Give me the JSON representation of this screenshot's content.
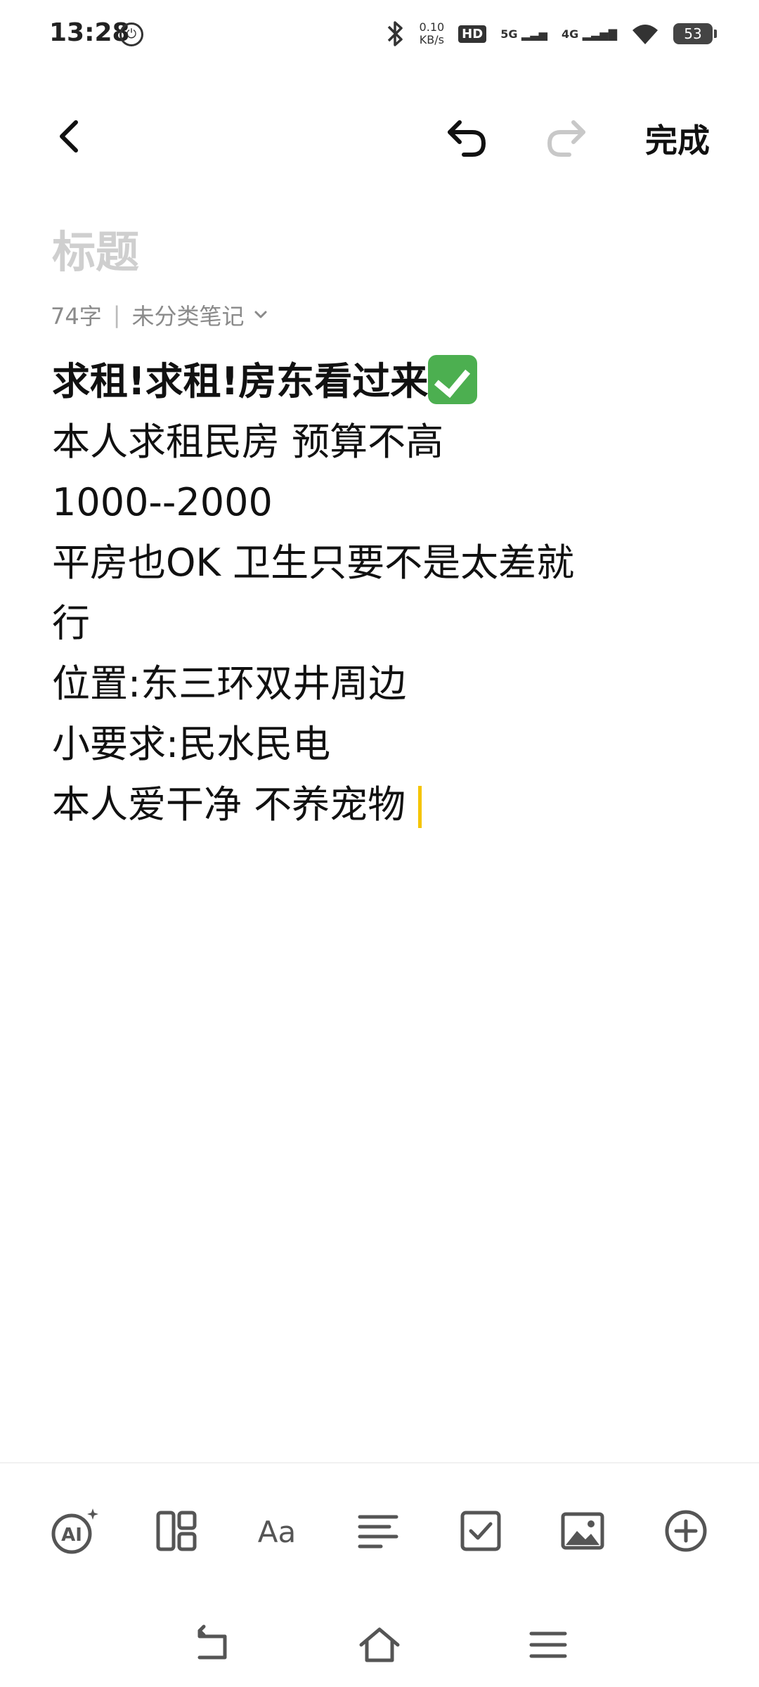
{
  "status_bar": {
    "time": "13:28",
    "network_speed_value": "0.10",
    "network_speed_unit": "KB/s",
    "hd_label": "HD",
    "sim1_label": "5G",
    "sim2_label": "4G",
    "battery": "53"
  },
  "toolbar": {
    "done_label": "完成"
  },
  "note": {
    "title_placeholder": "标题",
    "word_count": "74字",
    "category": "未分类笔记",
    "lines": [
      "求租!求租!房东看过来",
      "",
      "本人求租民房 预算不高",
      "1000--2000",
      "平房也OK 卫生只要不是太差就",
      "行",
      "位置:东三环双井周边",
      "小要求:民水民电",
      "",
      "本人爱干净 不养宠物"
    ]
  },
  "format_bar": {
    "text_style_label": "Aa",
    "ai_label": "AI"
  },
  "colors": {
    "cursor": "#f5c400",
    "check_emoji": "#4caf50",
    "placeholder": "#cfcfcf"
  }
}
